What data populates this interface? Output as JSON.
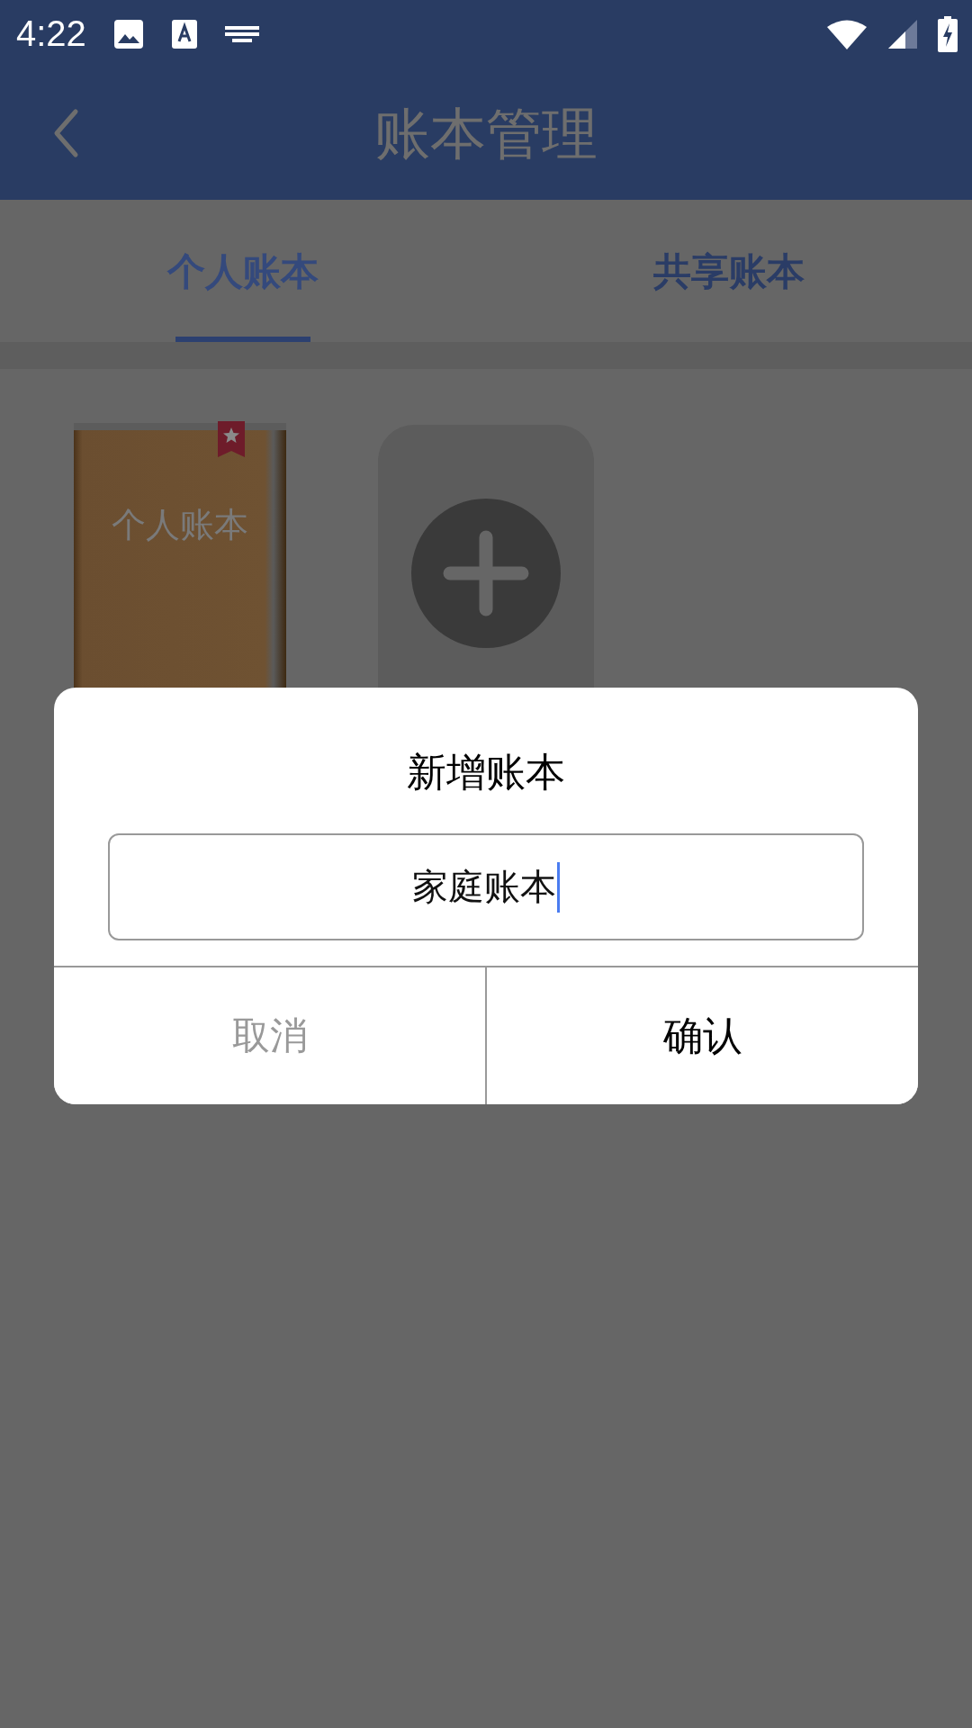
{
  "status_bar": {
    "time": "4:22"
  },
  "header": {
    "title": "账本管理"
  },
  "tabs": [
    {
      "label": "个人账本",
      "selected": true
    },
    {
      "label": "共享账本",
      "selected": false
    }
  ],
  "books": [
    {
      "title": "个人账本"
    }
  ],
  "dialog": {
    "title": "新增账本",
    "input": {
      "value": "家庭账本"
    },
    "buttons": [
      {
        "label": "取消",
        "kind": "cancel"
      },
      {
        "label": "确认",
        "kind": "confirm"
      }
    ]
  }
}
